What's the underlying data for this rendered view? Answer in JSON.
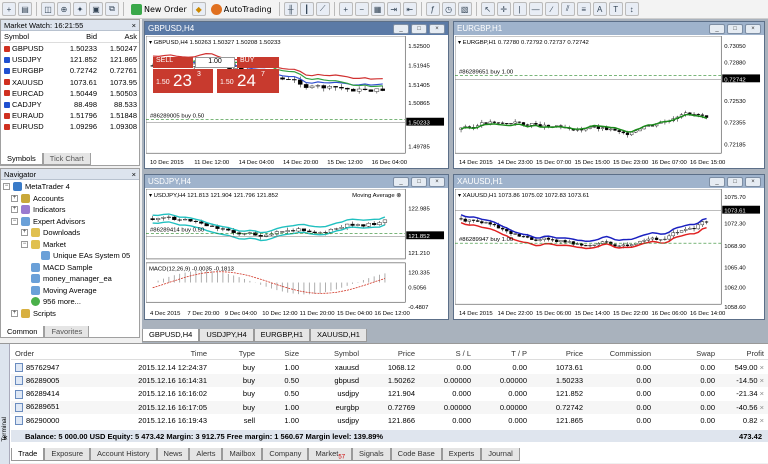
{
  "toolbar": {
    "new_order": "New Order",
    "autotrading": "AutoTrading"
  },
  "market_watch": {
    "title": "Market Watch: 16:21:55",
    "close": "×",
    "cols": [
      "Symbol",
      "Bid",
      "Ask"
    ],
    "rows": [
      {
        "s": "GBPUSD",
        "b": "1.50233",
        "a": "1.50247",
        "c": "#d03020"
      },
      {
        "s": "USDJPY",
        "b": "121.852",
        "a": "121.865",
        "c": "#2050d0"
      },
      {
        "s": "EURGBP",
        "b": "0.72742",
        "a": "0.72761",
        "c": "#2050d0"
      },
      {
        "s": "XAUUSD",
        "b": "1073.61",
        "a": "1073.95",
        "c": "#d03020"
      },
      {
        "s": "EURCAD",
        "b": "1.50449",
        "a": "1.50503",
        "c": "#d03020"
      },
      {
        "s": "CADJPY",
        "b": "88.498",
        "a": "88.533",
        "c": "#2050d0"
      },
      {
        "s": "EURAUD",
        "b": "1.51796",
        "a": "1.51848",
        "c": "#d03020"
      },
      {
        "s": "EURUSD",
        "b": "1.09296",
        "a": "1.09308",
        "c": "#d03020"
      }
    ],
    "tabs": [
      "Symbols",
      "Tick Chart"
    ]
  },
  "navigator": {
    "title": "Navigator",
    "items": [
      "MetaTrader 4",
      "Accounts",
      "Indicators",
      "Expert Advisors",
      "Downloads",
      "Market",
      "Unique EAs System 05",
      "MACD Sample",
      "money_manager_ea",
      "Moving Average",
      "956 more...",
      "Scripts"
    ],
    "tabs": [
      "Common",
      "Favorites"
    ]
  },
  "charts": {
    "gbpusd": {
      "title": "GBPUSD,H4",
      "info": "GBPUSD,H4  1.50263 1.50327 1.50208 1.50233",
      "sell": "SELL",
      "buy": "BUY",
      "lot": "1.00",
      "sell_big": "23",
      "sell_small": "3",
      "sell_pre": "1.50",
      "buy_big": "24",
      "buy_small": "7",
      "buy_pre": "1.50",
      "order": "#86289005 buy 0.50",
      "prices": [
        "1.52500",
        "1.51945",
        "1.51405",
        "1.50865",
        "1.50233",
        "1.49785"
      ],
      "times": [
        "10 Dec 2015",
        "11 Dec 12:00",
        "14 Dec 04:00",
        "14 Dec 20:00",
        "15 Dec 12:00",
        "16 Dec 04:00"
      ]
    },
    "eurgbp": {
      "title": "EURGBP,H1",
      "info": "EURGBP,H1  0.72780 0.72792 0.72737 0.72742",
      "order": "#86289651 buy 1.00",
      "prices": [
        "0.73050",
        "0.72880",
        "0.72742",
        "0.72530",
        "0.72355",
        "0.72185"
      ],
      "times": [
        "14 Dec 2015",
        "14 Dec 23:00",
        "15 Dec 07:00",
        "15 Dec 15:00",
        "15 Dec 23:00",
        "16 Dec 07:00",
        "16 Dec 15:00"
      ]
    },
    "usdjpy": {
      "title": "USDJPY,H4",
      "info": "USDJPY,H4  121.813 121.904 121.796 121.852",
      "indicator": "Moving Average",
      "order": "#86289414 buy 0.50",
      "macd": "MACD(12,26,9) -0.0035 -0.1813",
      "prices": [
        "122.985",
        "122.110",
        "121.852",
        "121.210",
        "120.335",
        "0.5056",
        "-0.4807"
      ],
      "times": [
        "4 Dec 2015",
        "7 Dec 20:00",
        "9 Dec 04:00",
        "10 Dec 12:00",
        "11 Dec 20:00",
        "15 Dec 04:00",
        "16 Dec 12:00"
      ]
    },
    "xauusd": {
      "title": "XAUUSD,H1",
      "info": "XAUUSD,H1  1073.86 1075.02 1072.83 1073.61",
      "order": "#86289947 buy 1.00",
      "prices": [
        "1075.70",
        "1073.61",
        "1072.30",
        "1068.90",
        "1065.40",
        "1062.00",
        "1058.60"
      ],
      "times": [
        "14 Dec 2015",
        "14 Dec 22:00",
        "15 Dec 06:00",
        "15 Dec 14:00",
        "15 Dec 22:00",
        "16 Dec 06:00",
        "16 Dec 14:00"
      ]
    }
  },
  "chart_tabs": [
    "GBPUSD,H4",
    "USDJPY,H4",
    "EURGBP,H1",
    "XAUUSD,H1"
  ],
  "terminal": {
    "side_label": "Terminal",
    "close": "×",
    "cols": [
      "Order",
      "Time",
      "Type",
      "Size",
      "Symbol",
      "Price",
      "S / L",
      "T / P",
      "Price",
      "Commission",
      "Swap",
      "Profit"
    ],
    "rows": [
      [
        "85762947",
        "2015.12.14 12:24:37",
        "buy",
        "1.00",
        "xauusd",
        "1068.12",
        "0.00",
        "0.00",
        "1073.61",
        "0.00",
        "0.00",
        "549.00"
      ],
      [
        "86289005",
        "2015.12.16 16:14:31",
        "buy",
        "0.50",
        "gbpusd",
        "1.50262",
        "0.00000",
        "0.00000",
        "1.50233",
        "0.00",
        "0.00",
        "-14.50"
      ],
      [
        "86289414",
        "2015.12.16 16:16:02",
        "buy",
        "0.50",
        "usdjpy",
        "121.904",
        "0.000",
        "0.000",
        "121.852",
        "0.00",
        "0.00",
        "-21.34"
      ],
      [
        "86289651",
        "2015.12.16 16:17:05",
        "buy",
        "1.00",
        "eurgbp",
        "0.72769",
        "0.00000",
        "0.00000",
        "0.72742",
        "0.00",
        "0.00",
        "-40.56"
      ],
      [
        "86290000",
        "2015.12.16 16:19:43",
        "sell",
        "1.00",
        "usdjpy",
        "121.866",
        "0.000",
        "0.000",
        "121.865",
        "0.00",
        "0.00",
        "0.82"
      ]
    ],
    "balance": "Balance: 5 000.00 USD  Equity: 5 473.42  Margin: 3 912.75  Free margin: 1 560.67  Margin level: 139.89%",
    "total": "473.42",
    "tabs": [
      "Trade",
      "Exposure",
      "Account History",
      "News",
      "Alerts",
      "Mailbox",
      "Company",
      "Market",
      "Signals",
      "Code Base",
      "Experts",
      "Journal"
    ],
    "market_badge": "57"
  }
}
